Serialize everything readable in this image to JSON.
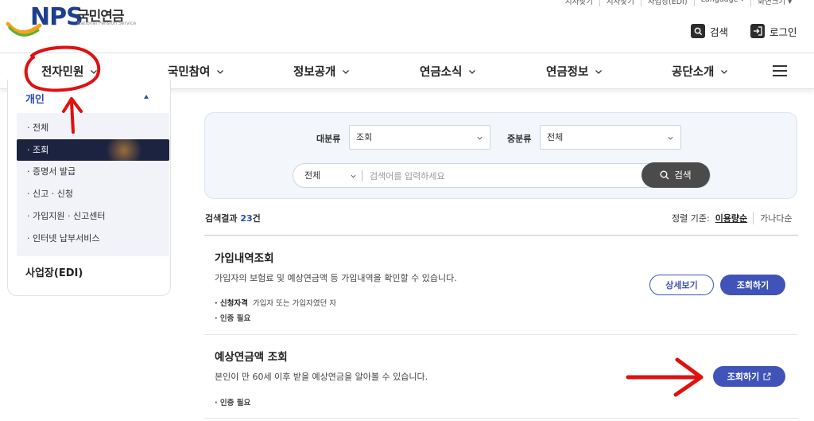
{
  "header": {
    "logo_text": "NPS",
    "logo_korean": "국민연금",
    "logo_english": "National Pension Service",
    "utility_links": [
      "지사찾기",
      "지사찾기",
      "사업장(EDI)",
      "Language ▾",
      "화면크기 ▾"
    ],
    "search_label": "검색",
    "login_label": "로그인"
  },
  "nav": {
    "items": [
      "전자민원",
      "국민참여",
      "정보공개",
      "연금소식",
      "연금정보",
      "공단소개"
    ]
  },
  "sidebar": {
    "section": "개인",
    "items": [
      "· 전체",
      "· 조회",
      "· 증명서 발급",
      "· 신고 · 신청",
      "· 가입지원 · 신고센터",
      "· 인터넷 납부서비스"
    ],
    "active_index": 1,
    "footer_section": "사업장(EDI)"
  },
  "search": {
    "category_label": "대분류",
    "category_value": "조회",
    "subcategory_label": "중분류",
    "subcategory_value": "전체",
    "scope_value": "전체",
    "keyword_placeholder": "검색어를 입력하세요",
    "button_label": "검색"
  },
  "results": {
    "count_prefix": "검색결과 ",
    "count": "23",
    "count_suffix": "건",
    "sort_label": "정렬 기준:",
    "sort_active": "이용량순",
    "sort_other": "가나다순",
    "items": [
      {
        "title": "가입내역조회",
        "description": "가입자의 보험료 및 예상연금액 등 가입내역을 확인할 수 있습니다.",
        "qualification_label": "· 신청자격",
        "qualification_value": "가입자 또는 가입자였던 자",
        "auth": "· 인증 필요",
        "detail_button": "상세보기",
        "action_button": "조회하기"
      },
      {
        "title": "예상연금액 조회",
        "description": "본인이 만 60세 이후 받을 예상연금을 알아볼 수 있습니다.",
        "auth": "· 인증 필요",
        "action_button": "조회하기"
      }
    ]
  },
  "colors": {
    "brand_blue": "#3f53b8",
    "nav_dark": "#1c2340",
    "annotation_red": "#e01010"
  }
}
